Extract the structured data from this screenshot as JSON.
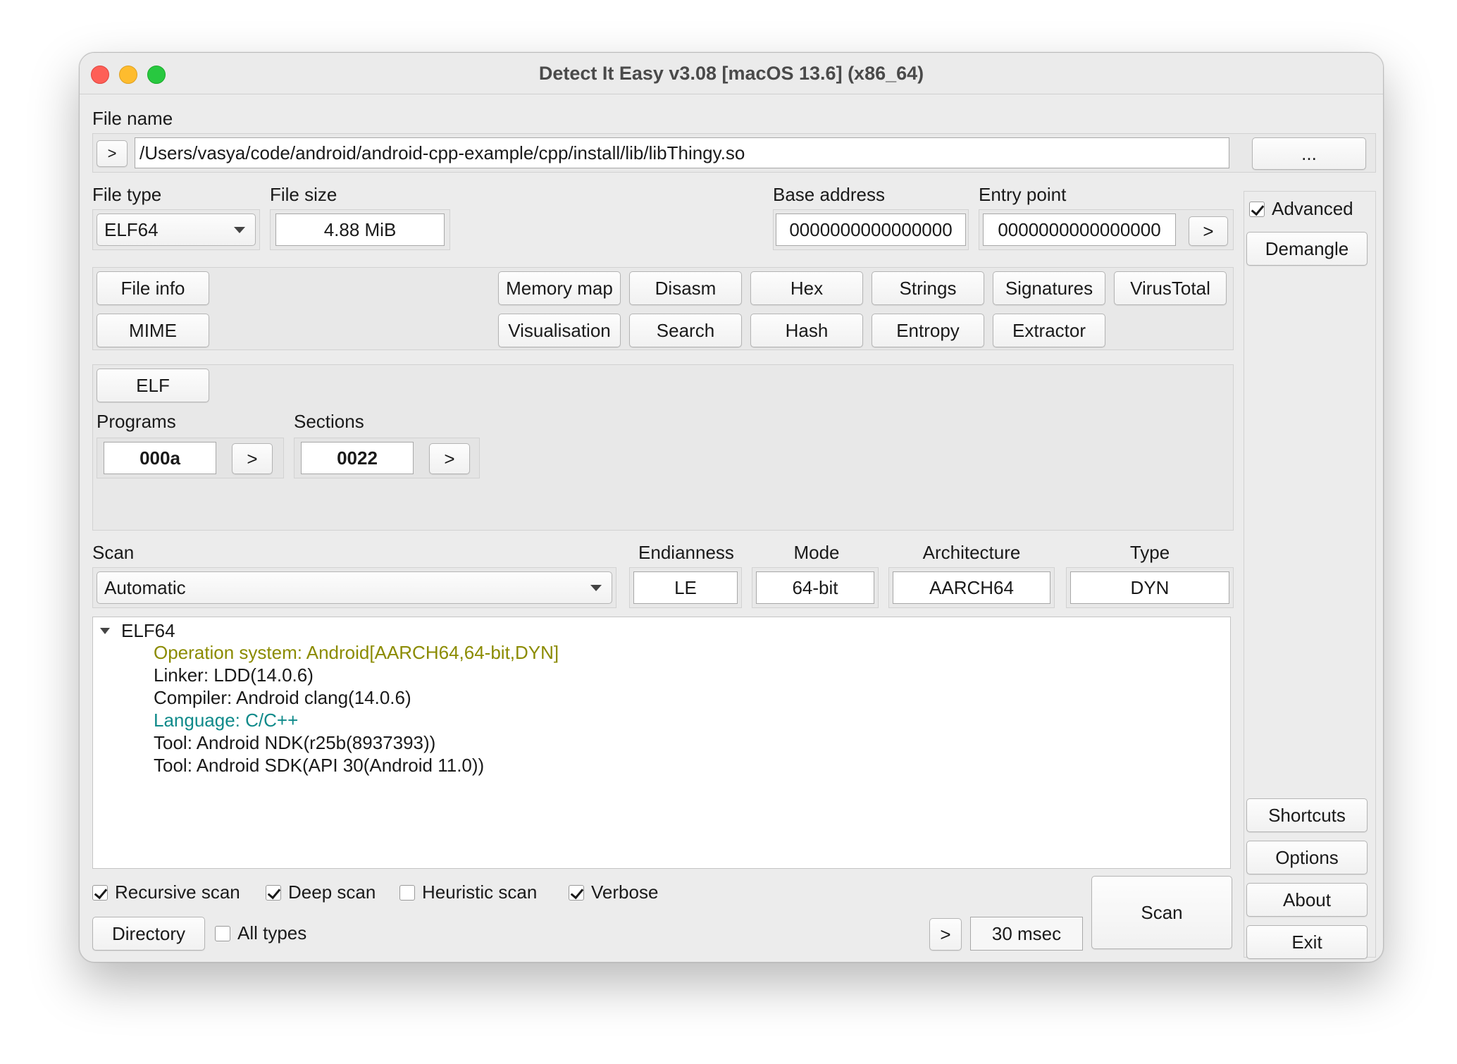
{
  "window": {
    "title": "Detect It Easy v3.08 [macOS 13.6] (x86_64)"
  },
  "file": {
    "label": "File name",
    "go_label": ">",
    "path": "/Users/vasya/code/android/android-cpp-example/cpp/install/lib/libThingy.so",
    "browse_label": "..."
  },
  "info": {
    "file_type_label": "File type",
    "file_type_value": "ELF64",
    "file_size_label": "File size",
    "file_size_value": "4.88 MiB",
    "base_address_label": "Base address",
    "base_address_value": "0000000000000000",
    "entry_point_label": "Entry point",
    "entry_point_value": "0000000000000000",
    "entry_go_label": ">"
  },
  "side": {
    "advanced_label": "Advanced",
    "advanced_checked": true,
    "demangle_label": "Demangle",
    "shortcuts_label": "Shortcuts",
    "options_label": "Options",
    "about_label": "About",
    "exit_label": "Exit"
  },
  "tools": {
    "file_info": "File info",
    "mime": "MIME",
    "memory_map": "Memory map",
    "disasm": "Disasm",
    "hex": "Hex",
    "strings": "Strings",
    "signatures": "Signatures",
    "virustotal": "VirusTotal",
    "visualisation": "Visualisation",
    "search": "Search",
    "hash": "Hash",
    "entropy": "Entropy",
    "extractor": "Extractor"
  },
  "elf": {
    "button_label": "ELF",
    "programs_label": "Programs",
    "programs_value": "000a",
    "programs_go": ">",
    "sections_label": "Sections",
    "sections_value": "0022",
    "sections_go": ">"
  },
  "scan": {
    "scan_label": "Scan",
    "scan_mode_value": "Automatic",
    "endianness_label": "Endianness",
    "endianness_value": "LE",
    "mode_label": "Mode",
    "mode_value": "64-bit",
    "architecture_label": "Architecture",
    "architecture_value": "AARCH64",
    "type_label": "Type",
    "type_value": "DYN"
  },
  "results": {
    "root": "ELF64",
    "items": [
      {
        "text": "Operation system: Android[AARCH64,64-bit,DYN]",
        "color": "#8b8b00"
      },
      {
        "text": "Linker: LDD(14.0.6)",
        "color": "#1a1a1a"
      },
      {
        "text": "Compiler: Android clang(14.0.6)",
        "color": "#1a1a1a"
      },
      {
        "text": "Language: C/C++",
        "color": "#0f8a8a"
      },
      {
        "text": "Tool: Android NDK(r25b(8937393))",
        "color": "#1a1a1a"
      },
      {
        "text": "Tool: Android SDK(API 30(Android 11.0))",
        "color": "#1a1a1a"
      }
    ]
  },
  "options": {
    "recursive_label": "Recursive scan",
    "recursive_checked": true,
    "deep_label": "Deep scan",
    "deep_checked": true,
    "heuristic_label": "Heuristic scan",
    "heuristic_checked": false,
    "verbose_label": "Verbose",
    "verbose_checked": true,
    "directory_label": "Directory",
    "all_types_label": "All types",
    "all_types_checked": false,
    "time_go": ">",
    "time_value": "30 msec",
    "scan_button_label": "Scan"
  },
  "colors": {
    "accent_olive": "#8b8b00",
    "accent_teal": "#0f8a8a"
  }
}
